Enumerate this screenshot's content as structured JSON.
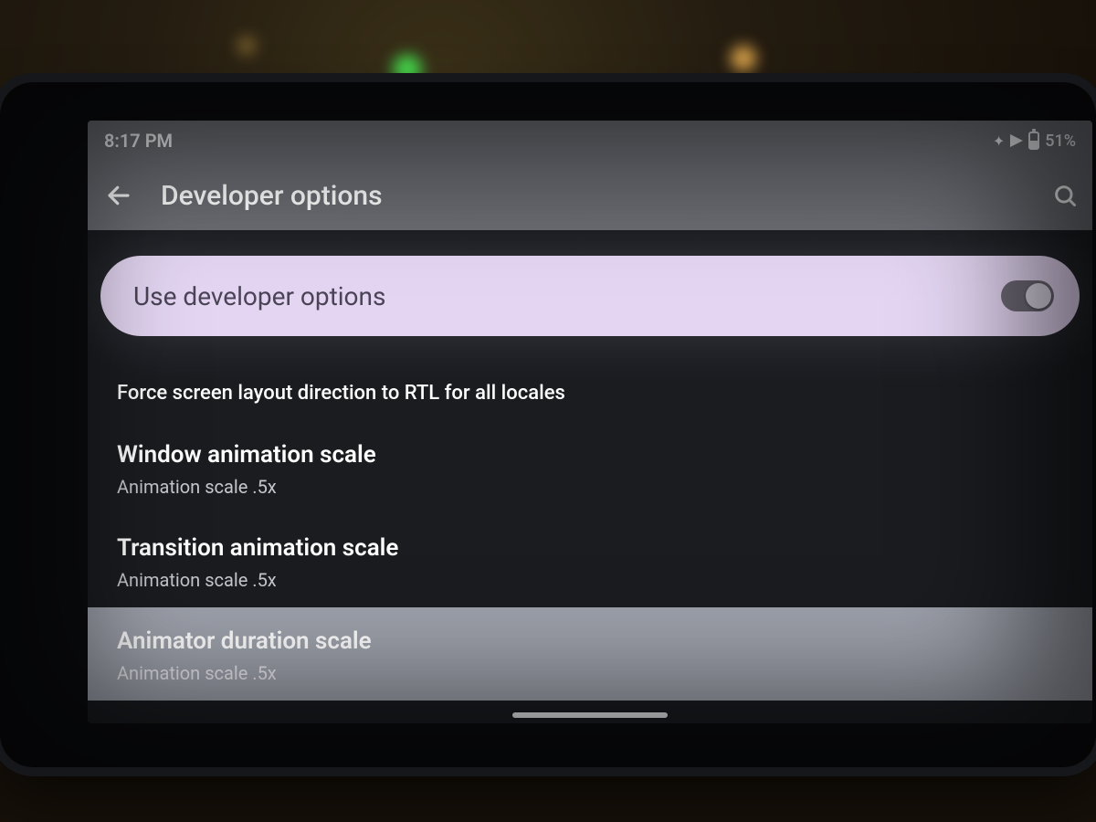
{
  "status": {
    "time": "8:17 PM",
    "battery_text": "51%"
  },
  "appbar": {
    "title": "Developer options"
  },
  "master_toggle": {
    "label": "Use developer options",
    "on": true
  },
  "items": [
    {
      "key": "force-rtl",
      "primary": "Force screen layout direction to RTL for all locales",
      "subtle": true
    },
    {
      "key": "window-anim",
      "primary": "Window animation scale",
      "secondary": "Animation scale .5x"
    },
    {
      "key": "transition-anim",
      "primary": "Transition animation scale",
      "secondary": "Animation scale .5x"
    },
    {
      "key": "animator-duration",
      "primary": "Animator duration scale",
      "secondary": "Animation scale .5x",
      "selected": true
    }
  ]
}
